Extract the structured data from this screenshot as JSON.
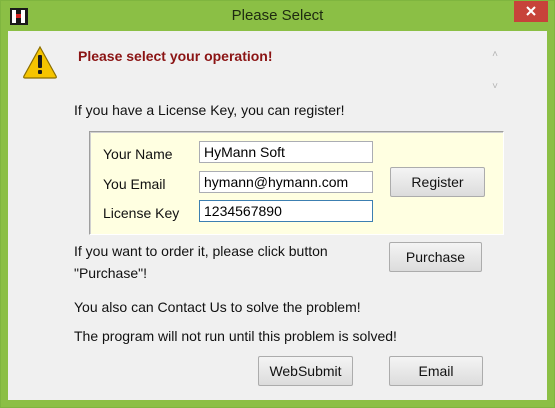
{
  "window": {
    "title": "Please Select",
    "close_symbol": "✕",
    "app_icon": "hymann-h-logo-icon"
  },
  "header": {
    "icon": "warning-icon",
    "message": "Please select your operation!",
    "message_color": "#8b1414"
  },
  "register_section": {
    "intro": "If you have a License Key, you can register!",
    "fields": {
      "name_label": "Your Name",
      "name_value": "HyMann Soft",
      "email_label": "You Email",
      "email_value": "hymann@hymann.com",
      "key_label": "License Key",
      "key_value": "1234567890"
    },
    "register_button": "Register",
    "panel_color": "#ffffe1"
  },
  "purchase_section": {
    "line1": "If you want to order it, please click button",
    "line2": "\"Purchase\"!",
    "purchase_button": "Purchase"
  },
  "contact_section": {
    "line1": "You also can Contact Us  to solve the problem!",
    "line2": "The program will not run until this problem is solved!"
  },
  "buttons": {
    "websubmit": "WebSubmit",
    "email": "Email"
  },
  "colors": {
    "titlebar": "#8bbf45",
    "close_button": "#c7433a",
    "dialog_bg": "#f0f0f0"
  }
}
